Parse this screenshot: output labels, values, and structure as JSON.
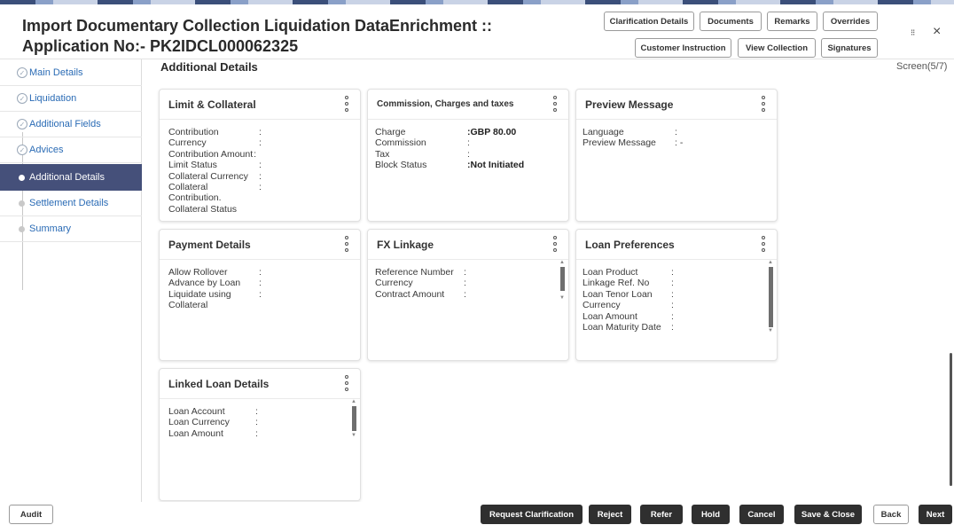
{
  "header": {
    "title_line1": "Import Documentary Collection Liquidation DataEnrichment ::",
    "title_line2": "Application No:- PK2IDCL000062325",
    "buttons_row1": [
      "Clarification Details",
      "Documents",
      "Remarks",
      "Overrides"
    ],
    "buttons_row2": [
      "Customer Instruction",
      "View Collection",
      "Signatures"
    ],
    "icons": {
      "minimize": "collapse-icon",
      "close": "close-icon"
    },
    "icon_glyphs": {
      "minimize": "⁝⁝",
      "close": "×"
    }
  },
  "sidebar": {
    "items": [
      {
        "label": "Main Details",
        "state": "done"
      },
      {
        "label": "Liquidation",
        "state": "done"
      },
      {
        "label": "Additional Fields",
        "state": "done"
      },
      {
        "label": "Advices",
        "state": "done"
      },
      {
        "label": "Additional Details",
        "state": "active"
      },
      {
        "label": "Settlement Details",
        "state": "pending"
      },
      {
        "label": "Summary",
        "state": "pending"
      }
    ]
  },
  "main": {
    "section_title": "Additional Details",
    "screen_indicator": "Screen(5/7)",
    "cards": [
      {
        "title": "Limit & Collateral",
        "rows": [
          {
            "key": "Contribution",
            "sep": ":",
            "value": ""
          },
          {
            "key": "Currency",
            "sep": ":",
            "value": ""
          },
          {
            "key": "Contribution Amount",
            "sep": ":",
            "value": ""
          },
          {
            "key": "Limit Status",
            "sep": ":",
            "value": ""
          },
          {
            "key": "Collateral Currency",
            "sep": ":",
            "value": ""
          },
          {
            "key": "Collateral",
            "sep": ":",
            "value": ""
          },
          {
            "key": "Contribution.",
            "sep": "",
            "value": ""
          },
          {
            "key": "Collateral Status",
            "sep": "",
            "value": ""
          }
        ]
      },
      {
        "title": "Commission, Charges and taxes",
        "rows": [
          {
            "key": "Charge",
            "sep": ": ",
            "value": "GBP  80.00"
          },
          {
            "key": "Commission",
            "sep": ":",
            "value": ""
          },
          {
            "key": "Tax",
            "sep": ":",
            "value": ""
          },
          {
            "key": "Block Status",
            "sep": ": ",
            "value": "Not Initiated"
          }
        ]
      },
      {
        "title": "Preview Message",
        "rows": [
          {
            "key": "Language",
            "sep": ":",
            "value": ""
          },
          {
            "key": "Preview Message",
            "sep": ": -",
            "value": ""
          }
        ]
      },
      {
        "title": "Payment Details",
        "rows": [
          {
            "key": "Allow Rollover",
            "sep": ":",
            "value": ""
          },
          {
            "key": "Advance by Loan",
            "sep": ":",
            "value": ""
          },
          {
            "key": "Liquidate using",
            "sep": ":",
            "value": ""
          },
          {
            "key": "Collateral",
            "sep": "",
            "value": ""
          }
        ]
      },
      {
        "title": "FX Linkage",
        "rows": [
          {
            "key": "Reference Number",
            "sep": ":",
            "value": ""
          },
          {
            "key": "Currency",
            "sep": ":",
            "value": ""
          },
          {
            "key": "Contract Amount",
            "sep": ":",
            "value": ""
          }
        ]
      },
      {
        "title": "Loan Preferences",
        "rows": [
          {
            "key": "Loan Product",
            "sep": ":",
            "value": ""
          },
          {
            "key": "Linkage Ref. No",
            "sep": ":",
            "value": ""
          },
          {
            "key": "Loan Tenor Loan",
            "sep": ":",
            "value": ""
          },
          {
            "key": "Currency",
            "sep": ":",
            "value": ""
          },
          {
            "key": "Loan Amount",
            "sep": ":",
            "value": ""
          },
          {
            "key": "Loan Maturity Date",
            "sep": ":",
            "value": ""
          }
        ]
      },
      {
        "title": "Linked Loan Details",
        "rows": [
          {
            "key": "Loan Account",
            "sep": ":",
            "value": ""
          },
          {
            "key": "Loan Currency",
            "sep": ":",
            "value": ""
          },
          {
            "key": "Loan Amount",
            "sep": ":",
            "value": ""
          }
        ]
      }
    ]
  },
  "footer": {
    "audit": "Audit",
    "actions": [
      "Request Clarification",
      "Reject",
      "Refer",
      "Hold",
      "Cancel",
      "Save & Close"
    ],
    "back": "Back",
    "next": "Next"
  }
}
